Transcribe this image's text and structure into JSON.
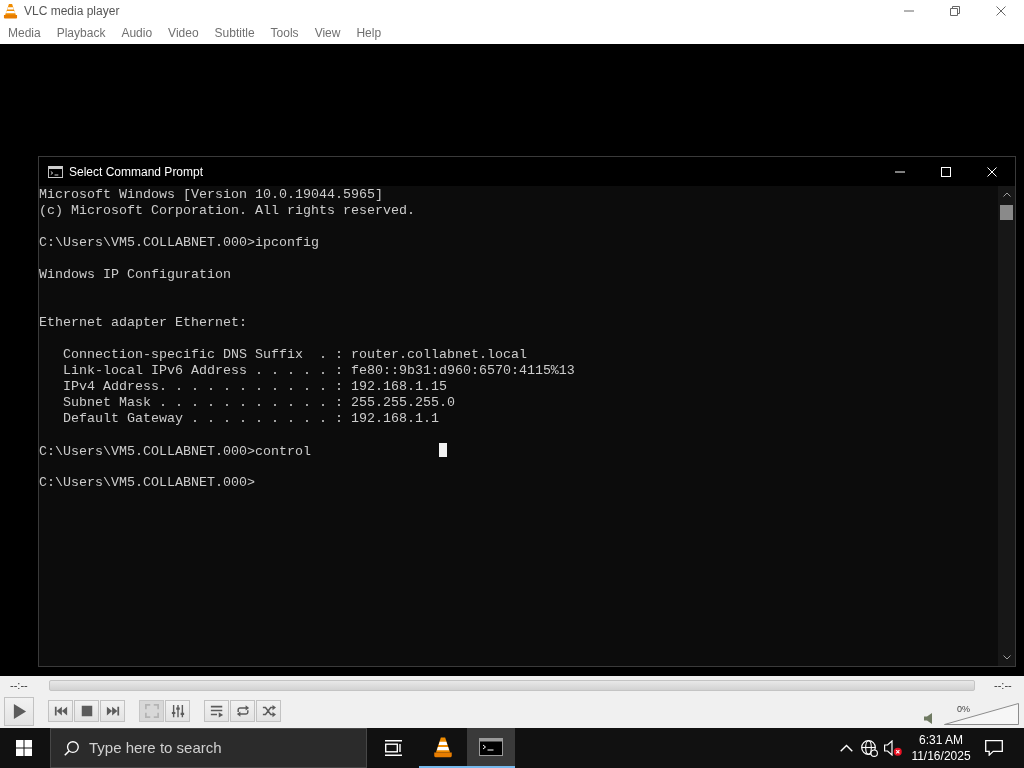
{
  "vlc_window": {
    "title": "VLC media player",
    "menu": [
      "Media",
      "Playback",
      "Audio",
      "Video",
      "Subtitle",
      "Tools",
      "View",
      "Help"
    ]
  },
  "console_window": {
    "title": "Select Command Prompt",
    "lines": [
      {
        "kind": "text",
        "text": "Microsoft Windows [Version 10.0.19044.5965]",
        "cursor": false
      },
      {
        "kind": "text",
        "text": "(c) Microsoft Corporation. All rights reserved.",
        "cursor": false
      },
      {
        "kind": "blank",
        "cursor": false
      },
      {
        "kind": "text",
        "text": "C:\\Users\\VM5.COLLABNET.000>ipconfig",
        "cursor": false
      },
      {
        "kind": "blank",
        "cursor": false
      },
      {
        "kind": "text",
        "text": "Windows IP Configuration",
        "cursor": false
      },
      {
        "kind": "blank",
        "cursor": false
      },
      {
        "kind": "blank",
        "cursor": false
      },
      {
        "kind": "text",
        "text": "Ethernet adapter Ethernet:",
        "cursor": false
      },
      {
        "kind": "blank",
        "cursor": false
      },
      {
        "kind": "indented",
        "text": "Connection-specific DNS Suffix  . : router.collabnet.local",
        "cursor": false
      },
      {
        "kind": "indented",
        "text": "Link-local IPv6 Address . . . . . : fe80::9b31:d960:6570:4115%13",
        "cursor": false
      },
      {
        "kind": "indented",
        "text": "IPv4 Address. . . . . . . . . . . : 192.168.1.15",
        "cursor": false
      },
      {
        "kind": "indented",
        "text": "Subnet Mask . . . . . . . . . . . : 255.255.255.0",
        "cursor": false
      },
      {
        "kind": "indented",
        "text": "Default Gateway . . . . . . . . . : 192.168.1.1",
        "cursor": false
      },
      {
        "kind": "blank",
        "cursor": false
      },
      {
        "kind": "text",
        "text": "C:\\Users\\VM5.COLLABNET.000>control",
        "cursor": true
      },
      {
        "kind": "blank",
        "cursor": false
      },
      {
        "kind": "text",
        "text": "C:\\Users\\VM5.COLLABNET.000>",
        "cursor": false
      }
    ]
  },
  "player_controls": {
    "elapsed": "--:--",
    "remaining": "--:--",
    "button_groups": [
      {
        "buttons": [
          {
            "kind": "play",
            "disabled": false
          }
        ]
      },
      {
        "buttons": [
          {
            "kind": "previous",
            "disabled": false
          },
          {
            "kind": "stop",
            "disabled": false
          },
          {
            "kind": "next",
            "disabled": false
          }
        ]
      },
      {
        "buttons": [
          {
            "kind": "fullscreen",
            "disabled": true
          },
          {
            "kind": "extended_settings",
            "disabled": false
          }
        ]
      },
      {
        "buttons": [
          {
            "kind": "playlist",
            "disabled": false
          },
          {
            "kind": "loop",
            "disabled": false
          },
          {
            "kind": "random",
            "disabled": false
          }
        ]
      }
    ],
    "volume": {
      "level": 0,
      "reading": "0%"
    }
  },
  "taskbar": {
    "search": {
      "placeholder": "Type here to search"
    },
    "apps": [
      {
        "kind": "vlc",
        "selected": false
      },
      {
        "kind": "console",
        "selected": true
      }
    ],
    "tray": {
      "volume_muted": true
    },
    "clock": {
      "time": "6:31 AM",
      "date": "11/16/2025"
    }
  }
}
